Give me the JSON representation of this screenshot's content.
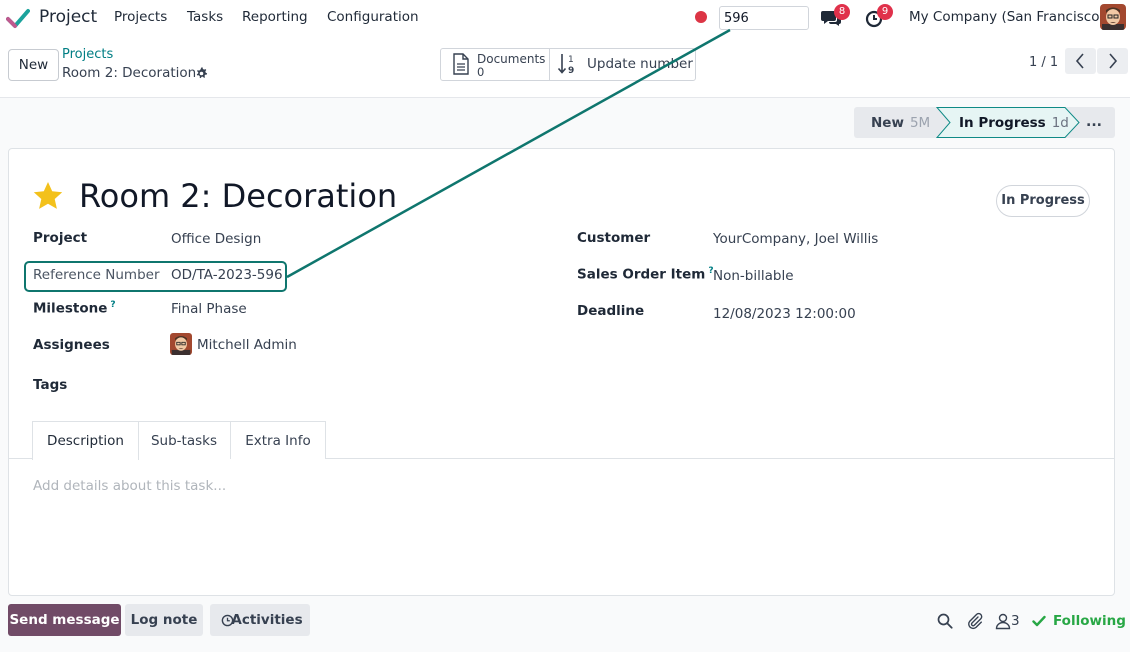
{
  "navbar": {
    "app_name": "Project",
    "menu": [
      "Projects",
      "Tasks",
      "Reporting",
      "Configuration"
    ],
    "search_value": "596",
    "messages_badge": "8",
    "activities_badge": "9",
    "company": "My Company (San Francisco)"
  },
  "control": {
    "new_label": "New",
    "breadcrumb_parent": "Projects",
    "breadcrumb_current": "Room 2: Decoration",
    "documents_label": "Documents",
    "documents_count": "0",
    "update_label": "Update number",
    "pager": "1 / 1"
  },
  "stages": {
    "new_label": "New",
    "new_count": "5M",
    "active_label": "In Progress",
    "active_count": "1d",
    "more_label": "..."
  },
  "form": {
    "title": "Room 2: Decoration",
    "status": "In Progress",
    "left_fields": {
      "project_label": "Project",
      "project_value": "Office Design",
      "reference_label": "Reference Number",
      "reference_value": "OD/TA-2023-596",
      "milestone_label": "Milestone",
      "milestone_value": "Final Phase",
      "assignees_label": "Assignees",
      "assignees_value": "Mitchell Admin",
      "tags_label": "Tags"
    },
    "right_fields": {
      "customer_label": "Customer",
      "customer_value": "YourCompany, Joel Willis",
      "sales_order_label": "Sales Order Item",
      "sales_order_value": "Non-billable",
      "deadline_label": "Deadline",
      "deadline_value": "12/08/2023 12:00:00"
    },
    "help_mark": "?",
    "tabs": [
      "Description",
      "Sub-tasks",
      "Extra Info"
    ],
    "description_placeholder": "Add details about this task..."
  },
  "chatter": {
    "send_label": "Send message",
    "log_label": "Log note",
    "activities_label": "Activities",
    "followers_count": "3",
    "following_label": "Following"
  },
  "colors": {
    "brand": "#714b67",
    "link": "#017e84",
    "annotation": "#0f766e",
    "badge": "#e0314b",
    "following": "#28a745"
  }
}
